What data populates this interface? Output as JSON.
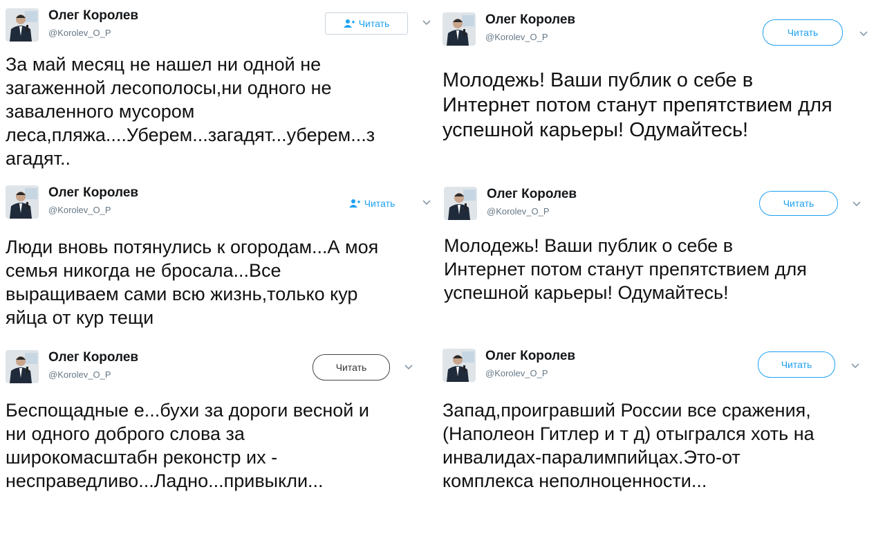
{
  "accent": "#1da1f2",
  "tweets": [
    {
      "name": "Олег Королев",
      "handle": "@Korolev_O_P",
      "follow_label": "Читать",
      "lines": [
        "За май месяц не нашел ни одной не",
        "загаженной лесополосы,ни одного не",
        "заваленного мусором",
        "леса,пляжа....Уберем...загадят...уберем...з",
        "агадят.."
      ]
    },
    {
      "name": "Олег Королев",
      "handle": "@Korolev_O_P",
      "follow_label": "Читать",
      "lines": [
        "Молодежь! Ваши публик о себе в",
        "Интернет потом станут препятствием для",
        "успешной карьеры! Одумайтесь!"
      ]
    },
    {
      "name": "Олег Королев",
      "handle": "@Korolev_O_P",
      "follow_label": "Читать",
      "lines": [
        "Люди вновь потянулись к огородам...А моя",
        "семья никогда не бросала...Все",
        "выращиваем сами всю жизнь,только кур",
        "яйца от кур тещи"
      ]
    },
    {
      "name": "Олег Королев",
      "handle": "@Korolev_O_P",
      "follow_label": "Читать",
      "lines": [
        "Молодежь! Ваши публик о себе в",
        "Интернет потом станут препятствием для",
        "успешной карьеры! Одумайтесь!"
      ]
    },
    {
      "name": "Олег Королев",
      "handle": "@Korolev_O_P",
      "follow_label": "Читать",
      "lines": [
        "Беспощадные е...бухи за дороги весной и",
        "ни одного доброго слова за",
        "широкомасштабн реконстр их -",
        "несправедливо...Ладно...привыкли..."
      ]
    },
    {
      "name": "Олег Королев",
      "handle": "@Korolev_O_P",
      "follow_label": "Читать",
      "lines": [
        "Запад,проигравший России все сражения,",
        "(Наполеон Гитлер и т д) отыгрался хоть на",
        "инвалидах-паралимпийцах.Это-от",
        "комплекса неполноценности..."
      ]
    }
  ]
}
